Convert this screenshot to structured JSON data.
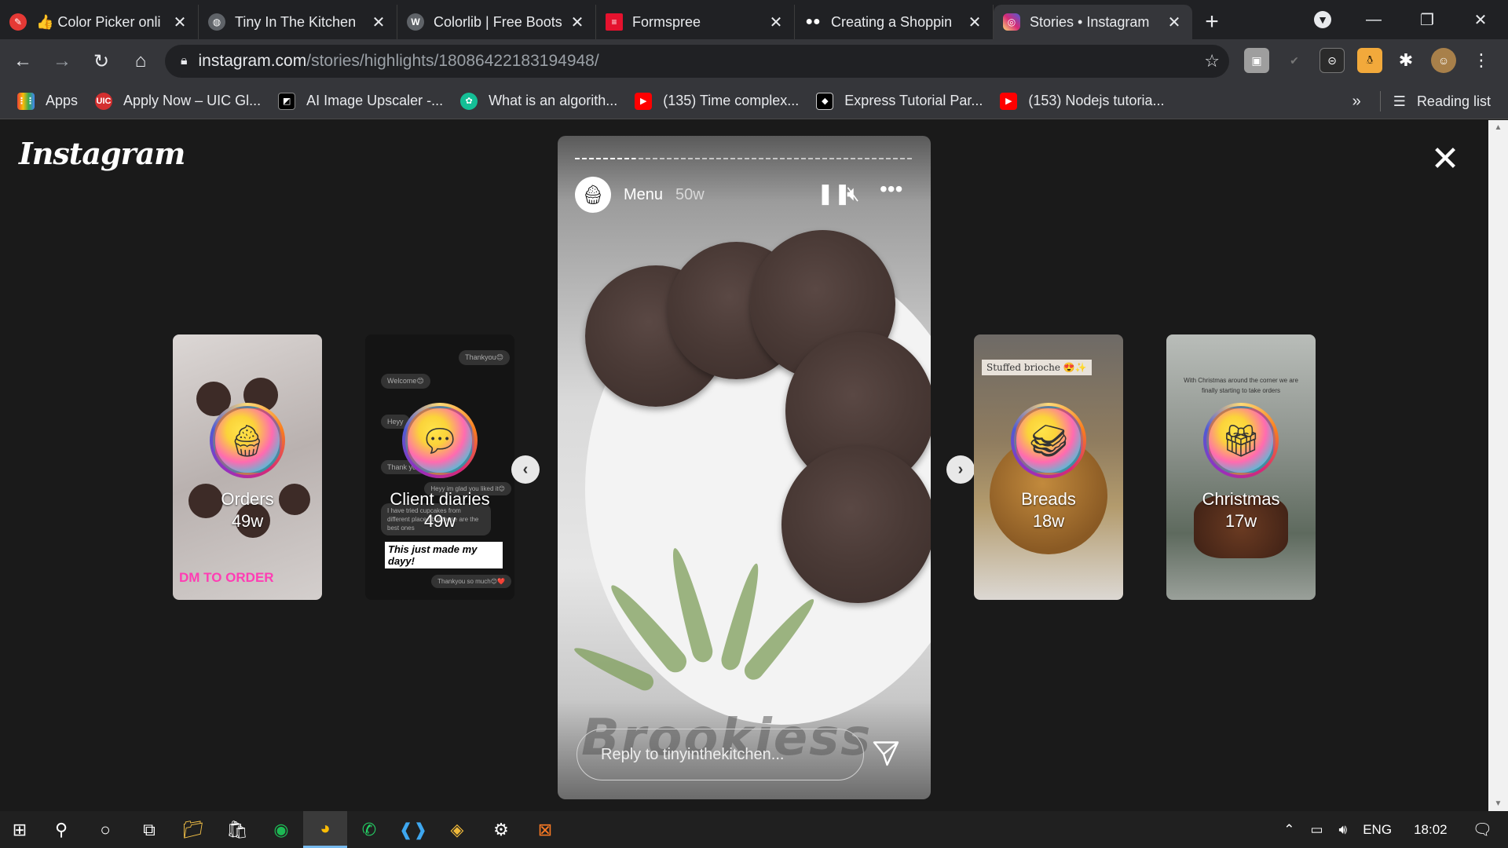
{
  "browser": {
    "tabs": [
      {
        "title": "👍 Color Picker onli",
        "favicon": "eyedropper-icon",
        "color": "#e53935"
      },
      {
        "title": "Tiny In The Kitchen",
        "favicon": "globe-icon",
        "color": "#5f6368"
      },
      {
        "title": "Colorlib | Free Boots",
        "favicon": "wordpress-icon",
        "color": "#5f6368"
      },
      {
        "title": "Formspree",
        "favicon": "formspree-icon",
        "color": "#e5122e"
      },
      {
        "title": "Creating a Shoppin",
        "favicon": "medium-icon",
        "color": "#202124"
      },
      {
        "title": "Stories • Instagram",
        "favicon": "instagram-icon",
        "color": "#c13584"
      }
    ],
    "active_tab_index": 5,
    "url_host": "instagram.com",
    "url_path": "/stories/highlights/18086422183194948/",
    "bookmarks": [
      {
        "label": "Apps",
        "icon": "apps-grid-icon",
        "color": "#ea4335"
      },
      {
        "label": "Apply Now – UIC Gl...",
        "icon": "uic-icon",
        "color": "#d32f2f"
      },
      {
        "label": "AI Image Upscaler -...",
        "icon": "upscaler-icon",
        "color": "#000000"
      },
      {
        "label": "What is an algorith...",
        "icon": "khan-icon",
        "color": "#14bf96"
      },
      {
        "label": "(135) Time complex...",
        "icon": "youtube-icon",
        "color": "#ff0000"
      },
      {
        "label": "Express Tutorial Par...",
        "icon": "mdn-icon",
        "color": "#000000"
      },
      {
        "label": "(153) Nodejs tutoria...",
        "icon": "youtube-icon",
        "color": "#ff0000"
      }
    ],
    "reading_list": "Reading list",
    "more_bookmarks": "»"
  },
  "instagram": {
    "logo": "Instagram",
    "highlights_left": [
      {
        "name": "Orders",
        "age": "49w",
        "icon": "cupcake-icon",
        "bg": "#c9c2c0",
        "caption": "DM TO ORDER"
      },
      {
        "name": "Client diaries",
        "age": "49w",
        "icon": "chat-icon",
        "bg": "#1b1b1b",
        "caption": ""
      }
    ],
    "highlights_right": [
      {
        "name": "Breads",
        "age": "18w",
        "icon": "sandwich-icon",
        "bg": "#c7b8a0",
        "caption": "Stuffed brioche 😍✨"
      },
      {
        "name": "Christmas",
        "age": "17w",
        "icon": "gift-icon",
        "bg": "#8a8f8a",
        "caption": "With Christmas around the corner we are finally starting to take orders"
      }
    ],
    "client_chat": {
      "bubble1": "Thankyou😊",
      "bubble2": "Welcome😊",
      "bubble3": "Heyy",
      "bubble4": "Thank you",
      "bubble5": "Heyy im glad you liked it😊",
      "bubble6": "I have tried cupcakes from different places but these are the best ones",
      "highlight": "This just made my dayy!",
      "bubble7": "Thankyou so much😊❤️"
    },
    "story": {
      "account": "Menu",
      "age": "50w",
      "overlay_text": "Brookiess",
      "reply_placeholder": "Reply to tinyinthekitchen...",
      "progress": 0.18
    }
  },
  "taskbar": {
    "lang": "ENG",
    "time": "18:02"
  }
}
